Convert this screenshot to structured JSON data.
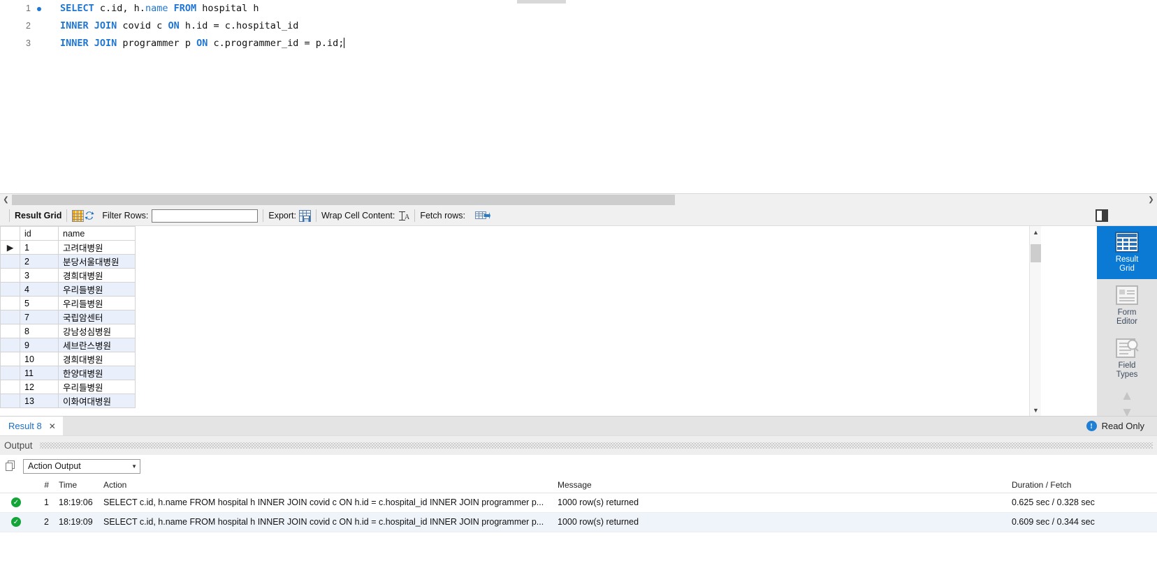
{
  "editor": {
    "lines": [
      {
        "number": "1",
        "breakpoint": true,
        "tokens": [
          {
            "t": "SELECT",
            "k": "kw"
          },
          {
            "t": " c.id, h.",
            "k": "plain"
          },
          {
            "t": "name",
            "k": "kwl"
          },
          {
            "t": " ",
            "k": "plain"
          },
          {
            "t": "FROM",
            "k": "kw"
          },
          {
            "t": " hospital h",
            "k": "plain"
          }
        ]
      },
      {
        "number": "2",
        "breakpoint": false,
        "tokens": [
          {
            "t": "INNER JOIN",
            "k": "kw"
          },
          {
            "t": " covid c ",
            "k": "plain"
          },
          {
            "t": "ON",
            "k": "kw"
          },
          {
            "t": " h.id = c.hospital_id",
            "k": "plain"
          }
        ]
      },
      {
        "number": "3",
        "breakpoint": false,
        "caret": true,
        "tokens": [
          {
            "t": "INNER JOIN",
            "k": "kw"
          },
          {
            "t": " programmer p ",
            "k": "plain"
          },
          {
            "t": "ON",
            "k": "kw"
          },
          {
            "t": " c.programmer_id = p.id;",
            "k": "plain"
          }
        ]
      }
    ]
  },
  "result_toolbar": {
    "result_grid_label": "Result Grid",
    "grid_icon": "grid-view-icon",
    "refresh_icon": "refresh-icon",
    "filter_rows_label": "Filter Rows:",
    "filter_value": "",
    "filter_placeholder": "",
    "export_label": "Export:",
    "export_icon": "export-recordset-icon",
    "wrap_cell_label": "Wrap Cell Content:",
    "wrap_icon": "wrap-text-icon",
    "fetch_rows_label": "Fetch rows:",
    "fetch_icon": "fetch-rows-icon",
    "panel_toggle_icon": "toggle-side-panel-icon"
  },
  "grid": {
    "columns": [
      "id",
      "name"
    ],
    "rows": [
      {
        "marker": "▶",
        "id": "1",
        "name": "고려대병원"
      },
      {
        "marker": "",
        "id": "2",
        "name": "분당서울대병원"
      },
      {
        "marker": "",
        "id": "3",
        "name": "경희대병원"
      },
      {
        "marker": "",
        "id": "4",
        "name": "우리들병원"
      },
      {
        "marker": "",
        "id": "5",
        "name": "우리들병원"
      },
      {
        "marker": "",
        "id": "7",
        "name": "국립암센터"
      },
      {
        "marker": "",
        "id": "8",
        "name": "강남성심병원"
      },
      {
        "marker": "",
        "id": "9",
        "name": "세브란스병원"
      },
      {
        "marker": "",
        "id": "10",
        "name": "경희대병원"
      },
      {
        "marker": "",
        "id": "11",
        "name": "한양대병원"
      },
      {
        "marker": "",
        "id": "12",
        "name": "우리들병원"
      },
      {
        "marker": "",
        "id": "13",
        "name": "이화여대병원"
      }
    ]
  },
  "side_panel": {
    "items": [
      {
        "label_line1": "Result",
        "label_line2": "Grid",
        "icon": "result-grid-icon",
        "active": true
      },
      {
        "label_line1": "Form",
        "label_line2": "Editor",
        "icon": "form-editor-icon",
        "active": false
      },
      {
        "label_line1": "Field",
        "label_line2": "Types",
        "icon": "field-types-icon",
        "active": false
      }
    ]
  },
  "result_tabbar": {
    "tab_label": "Result 8",
    "close_icon": "close-icon",
    "info_icon": "info-icon",
    "readonly_label": "Read Only"
  },
  "output": {
    "section_title": "Output",
    "copy_icon": "copy-icon",
    "selected_view": "Action Output",
    "columns": [
      "#",
      "Time",
      "Action",
      "Message",
      "Duration / Fetch"
    ],
    "rows": [
      {
        "status": "success",
        "num": "1",
        "time": "18:19:06",
        "action": "SELECT c.id, h.name FROM hospital h  INNER JOIN covid c ON h.id = c.hospital_id INNER JOIN programmer p...",
        "message": "1000 row(s) returned",
        "duration": "0.625 sec / 0.328 sec"
      },
      {
        "status": "success",
        "num": "2",
        "time": "18:19:09",
        "action": "SELECT c.id, h.name FROM hospital h  INNER JOIN covid c ON h.id = c.hospital_id INNER JOIN programmer p...",
        "message": "1000 row(s) returned",
        "duration": "0.609 sec / 0.344 sec"
      }
    ]
  },
  "colors": {
    "accent_blue": "#0a7ad4",
    "keyword_blue": "#1f76d2",
    "success_green": "#13a538",
    "row_alt": "#eaf0fb"
  }
}
